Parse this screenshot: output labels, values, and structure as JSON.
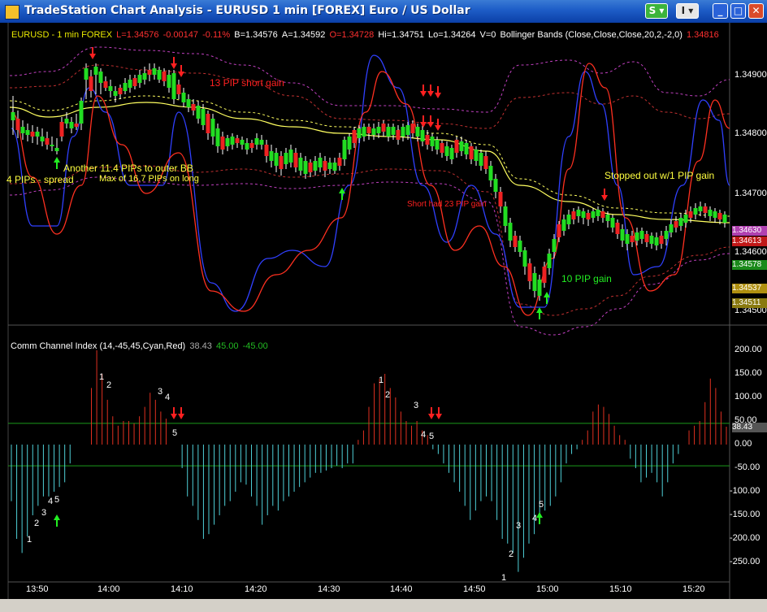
{
  "window": {
    "title": "TradeStation Chart Analysis - EURUSD 1 min [FOREX] Euro / US Dollar",
    "btn_s": "S ▾",
    "btn_i": "I ▾",
    "btn_min": "_",
    "btn_max": "□",
    "btn_close": "✕"
  },
  "price_header": {
    "symbol": "EURUSD - 1 min  FOREX",
    "last": "L=1.34576",
    "change": "-0.00147",
    "pct": "-0.11%",
    "bid": "B=1.34576",
    "ask": "A=1.34592",
    "open": "O=1.34728",
    "high": "Hi=1.34751",
    "low": "Lo=1.34264",
    "volume": "V=0",
    "indicator": "Bollinger Bands (Close,Close,Close,20,2,-2,0)",
    "ind_value": "1.34816"
  },
  "price_axis": [
    "1.34900",
    "1.34800",
    "1.34700",
    "1.34600",
    "1.34500"
  ],
  "price_tags": [
    {
      "text": "1.34630",
      "color": "#b040b0"
    },
    {
      "text": "1.34613",
      "color": "#c01818"
    },
    {
      "text": "1.34578",
      "color": "#1a8a1a"
    },
    {
      "text": "1.34537",
      "color": "#b09010"
    },
    {
      "text": "1.34511",
      "color": "#8a7a10"
    }
  ],
  "annotations": {
    "short13": "13 PIP short gain",
    "another": "Another 11.4 PIPs to outer BB",
    "spread": "4 PIPs - spread",
    "maxlong": "Max of 16.7 PIPs on long",
    "short23": "Short had 23 PIP gain",
    "tenpip": "10 PIP gain",
    "stopped": "Stopped out w/1 PIP gain"
  },
  "cci_header": {
    "name": "Comm Channel Index (14,-45,45,Cyan,Red)",
    "value": "38.43",
    "upper": "45.00",
    "lower": "-45.00"
  },
  "cci_axis": [
    "200.00",
    "150.00",
    "100.00",
    "50.00",
    "0.00",
    "-50.00",
    "-100.00",
    "-150.00",
    "-200.00",
    "-250.00"
  ],
  "cci_tag": "38.43",
  "time_axis": [
    "13:50",
    "14:00",
    "14:10",
    "14:20",
    "14:30",
    "14:40",
    "14:50",
    "15:00",
    "15:10",
    "15:20"
  ],
  "wave_labels": [
    "1",
    "2",
    "3",
    "4",
    "5",
    "1",
    "2",
    "3",
    "4",
    "5",
    "1",
    "2",
    "3",
    "4",
    "5",
    "1",
    "2",
    "3",
    "4",
    "5"
  ],
  "colors": {
    "up": "#22dd22",
    "down": "#ee2222",
    "cci_pos": "#e03020",
    "cci_neg": "#4fd0d8",
    "bb": "#c040c0",
    "ma": "#ffff60",
    "fast": "#3040ff",
    "slow": "#ff3020"
  }
}
